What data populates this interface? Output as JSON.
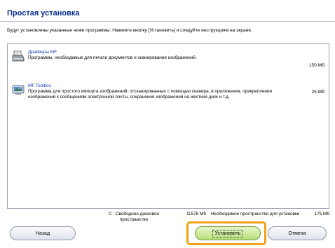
{
  "header": {
    "title": "Простая установка"
  },
  "instruction": "Будут установлены указанные ниже программы. Нажмите кнопку [Установить] и следуйте инструкциям на экране.",
  "items": [
    {
      "name": "Драйверы MF",
      "description": "Программы, необходимые для печати документов и сканирования изображений.",
      "size": "150 Мб",
      "icon": "printer-icon"
    },
    {
      "name": "MF Toolbox",
      "description": "Программа для простого импорта изображений, отсканированных с помощью сканера, в приложения, прикрепления изображений к сообщениям электронной почты, сохранения изображений на жесткий диск и т.д.",
      "size": "25 Мб",
      "icon": "toolbox-icon"
    }
  ],
  "disk": {
    "free_label": "C : Свободное дисковое пространство",
    "free_value": "11578 Мб",
    "required_label": "Необходимое пространство для установки",
    "required_value": "175 Мб"
  },
  "buttons": {
    "back": "Назад",
    "install": "Установить",
    "cancel": "Отмена"
  },
  "colors": {
    "title": "#0a2f8f",
    "item_name": "#1a3fb0",
    "highlight": "#f0a316",
    "install_button": "#b8e07c"
  }
}
